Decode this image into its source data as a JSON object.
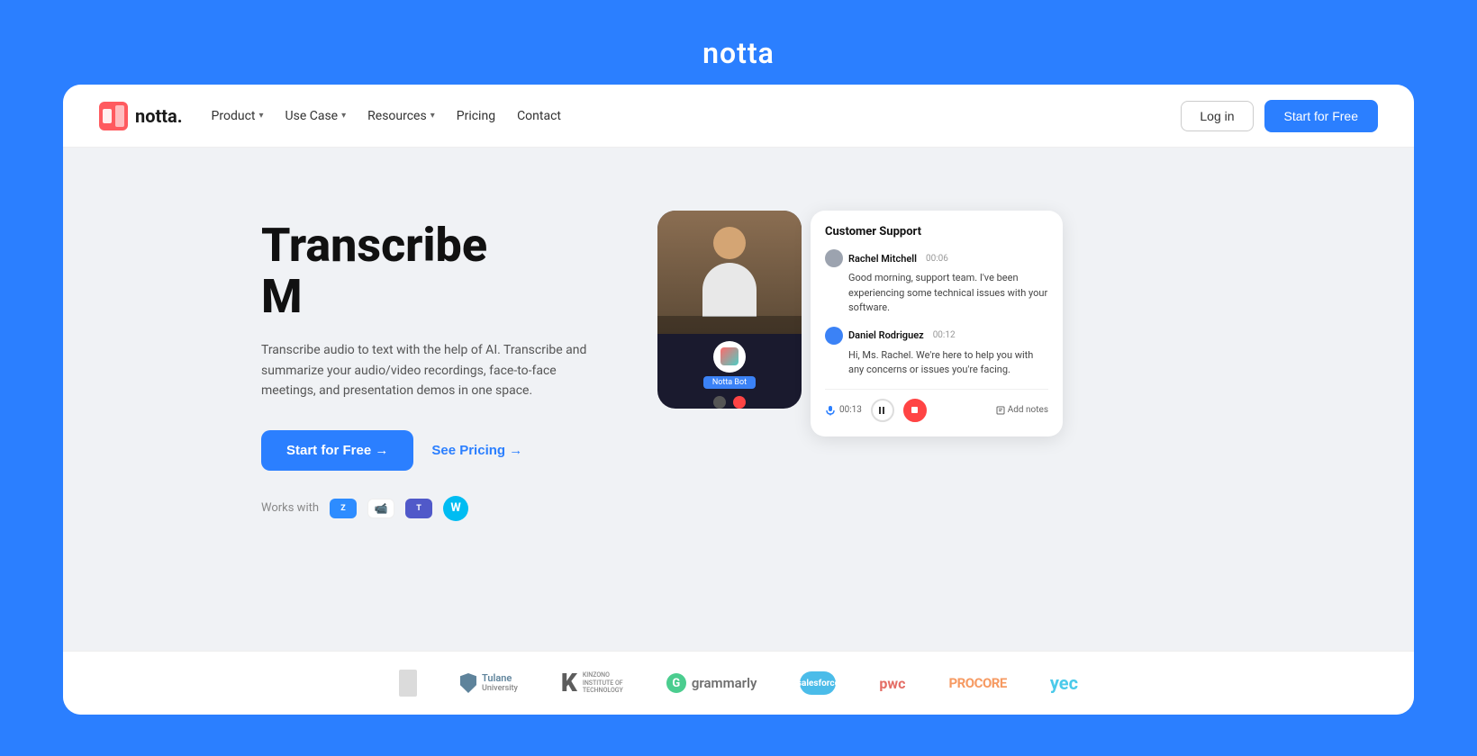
{
  "page": {
    "background_color": "#2B7FFF",
    "top_title": "notta"
  },
  "navbar": {
    "logo_text": "notta.",
    "nav_items": [
      {
        "label": "Product",
        "has_dropdown": true
      },
      {
        "label": "Use Case",
        "has_dropdown": true
      },
      {
        "label": "Resources",
        "has_dropdown": true
      },
      {
        "label": "Pricing",
        "has_dropdown": false
      },
      {
        "label": "Contact",
        "has_dropdown": false
      }
    ],
    "login_label": "Log in",
    "start_label": "Start for Free"
  },
  "hero": {
    "heading_line1": "Transcribe",
    "heading_line2": "M",
    "description": "Transcribe audio to text with the help of AI. Transcribe and summarize your audio/video recordings, face-to-face meetings, and presentation demos in one space.",
    "cta_start": "Start for Free →",
    "cta_pricing": "See Pricing →",
    "works_with_label": "Works with"
  },
  "chat_demo": {
    "title": "Customer Support",
    "messages": [
      {
        "sender": "Rachel Mitchell",
        "time": "00:06",
        "text": "Good morning, support team. I've been experiencing some technical issues with your software."
      },
      {
        "sender": "Daniel Rodriguez",
        "time": "00:12",
        "text": "Hi, Ms. Rachel. We're here to help you with any concerns or issues you're facing."
      }
    ],
    "timer": "00:13",
    "add_notes_label": "Add notes"
  },
  "video_demo": {
    "notta_bot_label": "Notta Bot"
  },
  "logos": {
    "companies": [
      {
        "name": "Tulane University",
        "type": "text-with-icon"
      },
      {
        "name": "Kinzono Institute of Technology",
        "type": "k-icon"
      },
      {
        "name": "Grammarly",
        "type": "g-circle"
      },
      {
        "name": "Salesforce",
        "type": "cloud"
      },
      {
        "name": "PwC",
        "type": "text"
      },
      {
        "name": "PROCORE",
        "type": "text-orange"
      },
      {
        "name": "yec",
        "type": "text-blue"
      }
    ]
  }
}
